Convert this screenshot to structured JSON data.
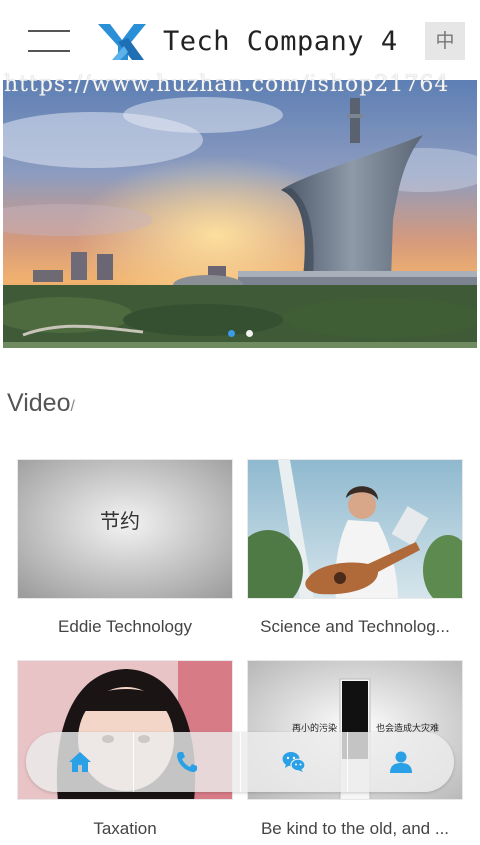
{
  "header": {
    "brand": "Tech Company 4",
    "lang_toggle": "中",
    "colors": {
      "logo_blue": "#2a8fd6",
      "lang_bg": "#e6e6e6"
    }
  },
  "banner": {
    "watermark": "https://www.huzhan.com/ishop21764",
    "slides_count": 2,
    "active_slide": 1,
    "image": "city-sunset-tower-photo"
  },
  "section": {
    "title": "Video",
    "suffix": "/"
  },
  "videos": [
    {
      "caption": "Eddie Technology",
      "thumb_text": "节约",
      "image": "gray-gradient-title-card"
    },
    {
      "caption": "Science and Technolog...",
      "image": "man-playing-guitar-photo"
    },
    {
      "caption": "Taxation",
      "image": "girl-portrait-photo"
    },
    {
      "caption": "Be kind to the old, and ...",
      "thumb_text_left": "再小的污染",
      "thumb_text_right": "也会造成大灾难",
      "image": "pollution-psa-card"
    }
  ],
  "bottom_nav": {
    "items": [
      {
        "icon": "home-icon"
      },
      {
        "icon": "phone-icon"
      },
      {
        "icon": "wechat-icon"
      },
      {
        "icon": "user-icon"
      }
    ],
    "accent": "#2aa0e6"
  }
}
